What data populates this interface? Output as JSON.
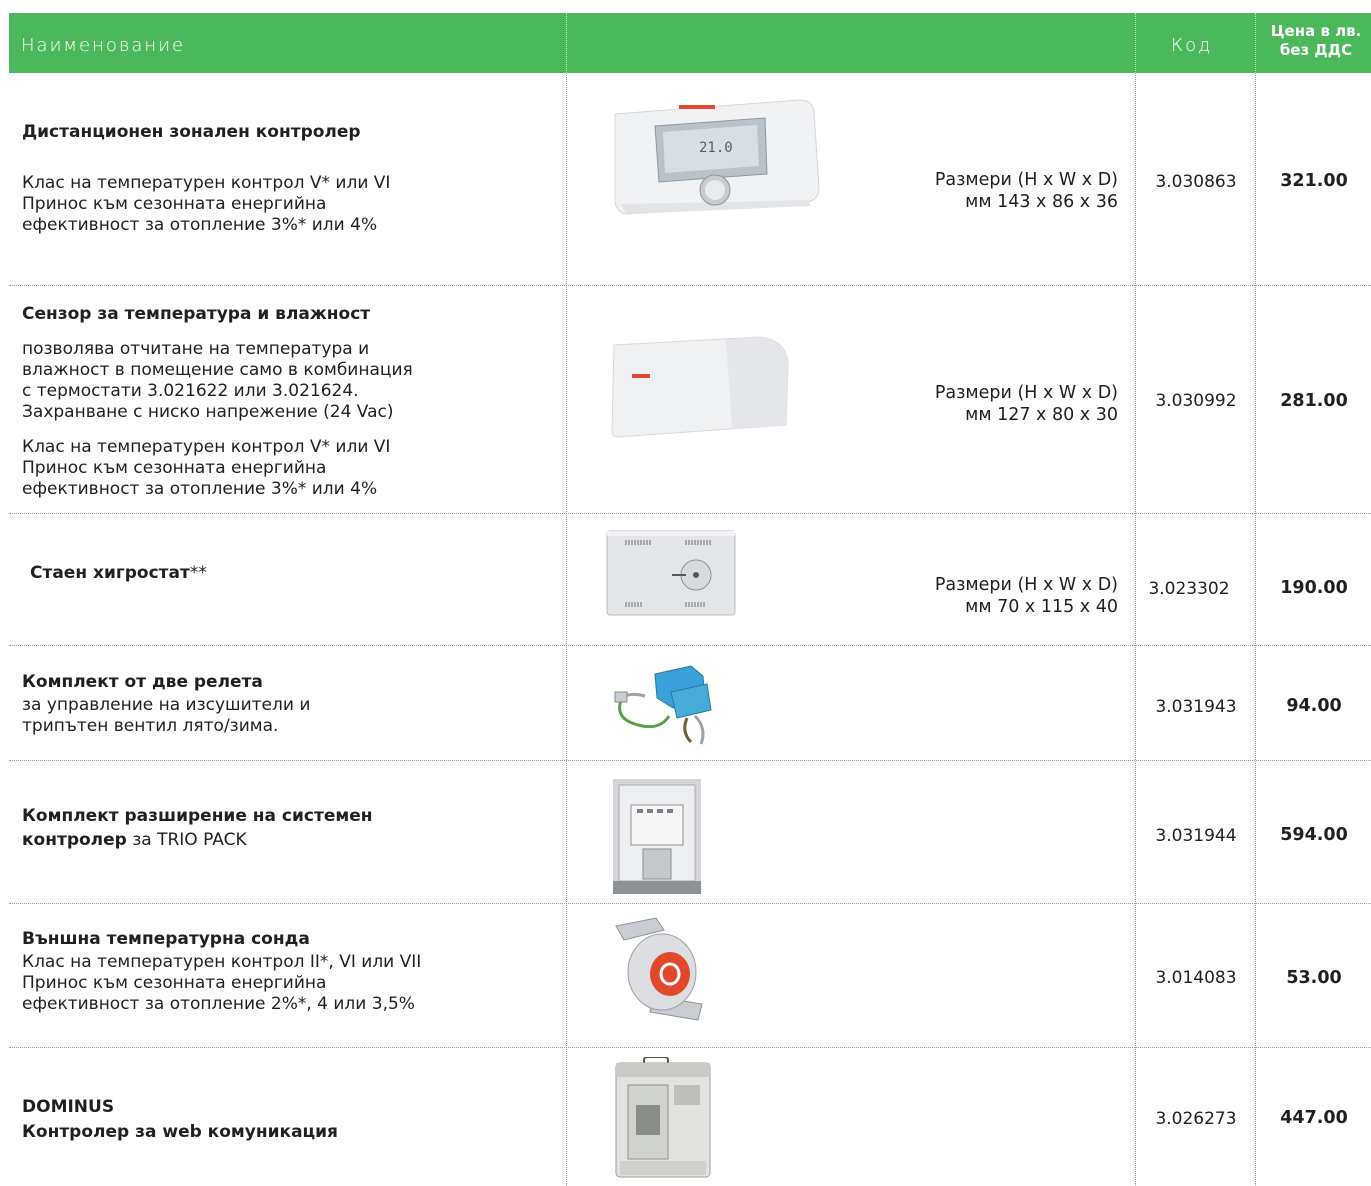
{
  "header": {
    "name": "Наименование",
    "code": "Код",
    "price_line1": "Цена в лв.",
    "price_line2": "без ДДС"
  },
  "rows": [
    {
      "title": "Дистанционен зонален контролер",
      "text1": "Клас на температурен контрол V* или VI\nПринос към сезонната енергийна\nефективност за отопление 3%* или 4%",
      "dims": "Размери (H x W x D)\nмм 143 x 86 x 36",
      "code": "3.030863",
      "price": "321.00",
      "image": "room-controller-image"
    },
    {
      "title": "Сензор за температура и влажност",
      "text1": "позволява отчитане на температура и\nвлажност в помещение само в комбинация\nс термостати 3.021622 или 3.021624.\nЗахранване с ниско напрежение (24 Vac)",
      "text2": "Клас на температурен контрол V* или VI\nПринос към сезонната енергийна\nефективност за отопление 3%* или 4%",
      "dims": "Размери (H x W x D)\nмм 127 x 80 x 30",
      "code": "3.030992",
      "price": "281.00",
      "image": "humidity-sensor-image"
    },
    {
      "title": "Стаен хигростат",
      "title_suffix": "**",
      "dims": "Размери (H x W x D)\nмм 70 x 115 x 40",
      "code": "3.023302",
      "price": "190.00",
      "image": "hygrostat-image"
    },
    {
      "title": "Комплект от две релета",
      "text1": "за управление на изсушители и\nтрипътен вентил лято/зима.",
      "code": "3.031943",
      "price": "94.00",
      "image": "relay-kit-image"
    },
    {
      "title": "Комплект разширение на системен",
      "title2": "контролер",
      "title2_suffix": " за TRIO PACK",
      "code": "3.031944",
      "price": "594.00",
      "image": "expansion-kit-image"
    },
    {
      "title": "Външна температурна сонда",
      "text1": "Клас на температурен контрол  II*, VI  или  VII\nПринос към сезонната енергийна\nефективност за отопление 2%*, 4 или 3,5%",
      "code": "3.014083",
      "price": "53.00",
      "image": "outdoor-probe-image"
    },
    {
      "title": "DOMINUS",
      "title2": "Контролер за web комуникация",
      "code": "3.026273",
      "price": "447.00",
      "image": "dominus-image"
    }
  ],
  "colors": {
    "header_green": "#4cb85c",
    "text": "#231f20",
    "accent_red": "#e2492c"
  }
}
